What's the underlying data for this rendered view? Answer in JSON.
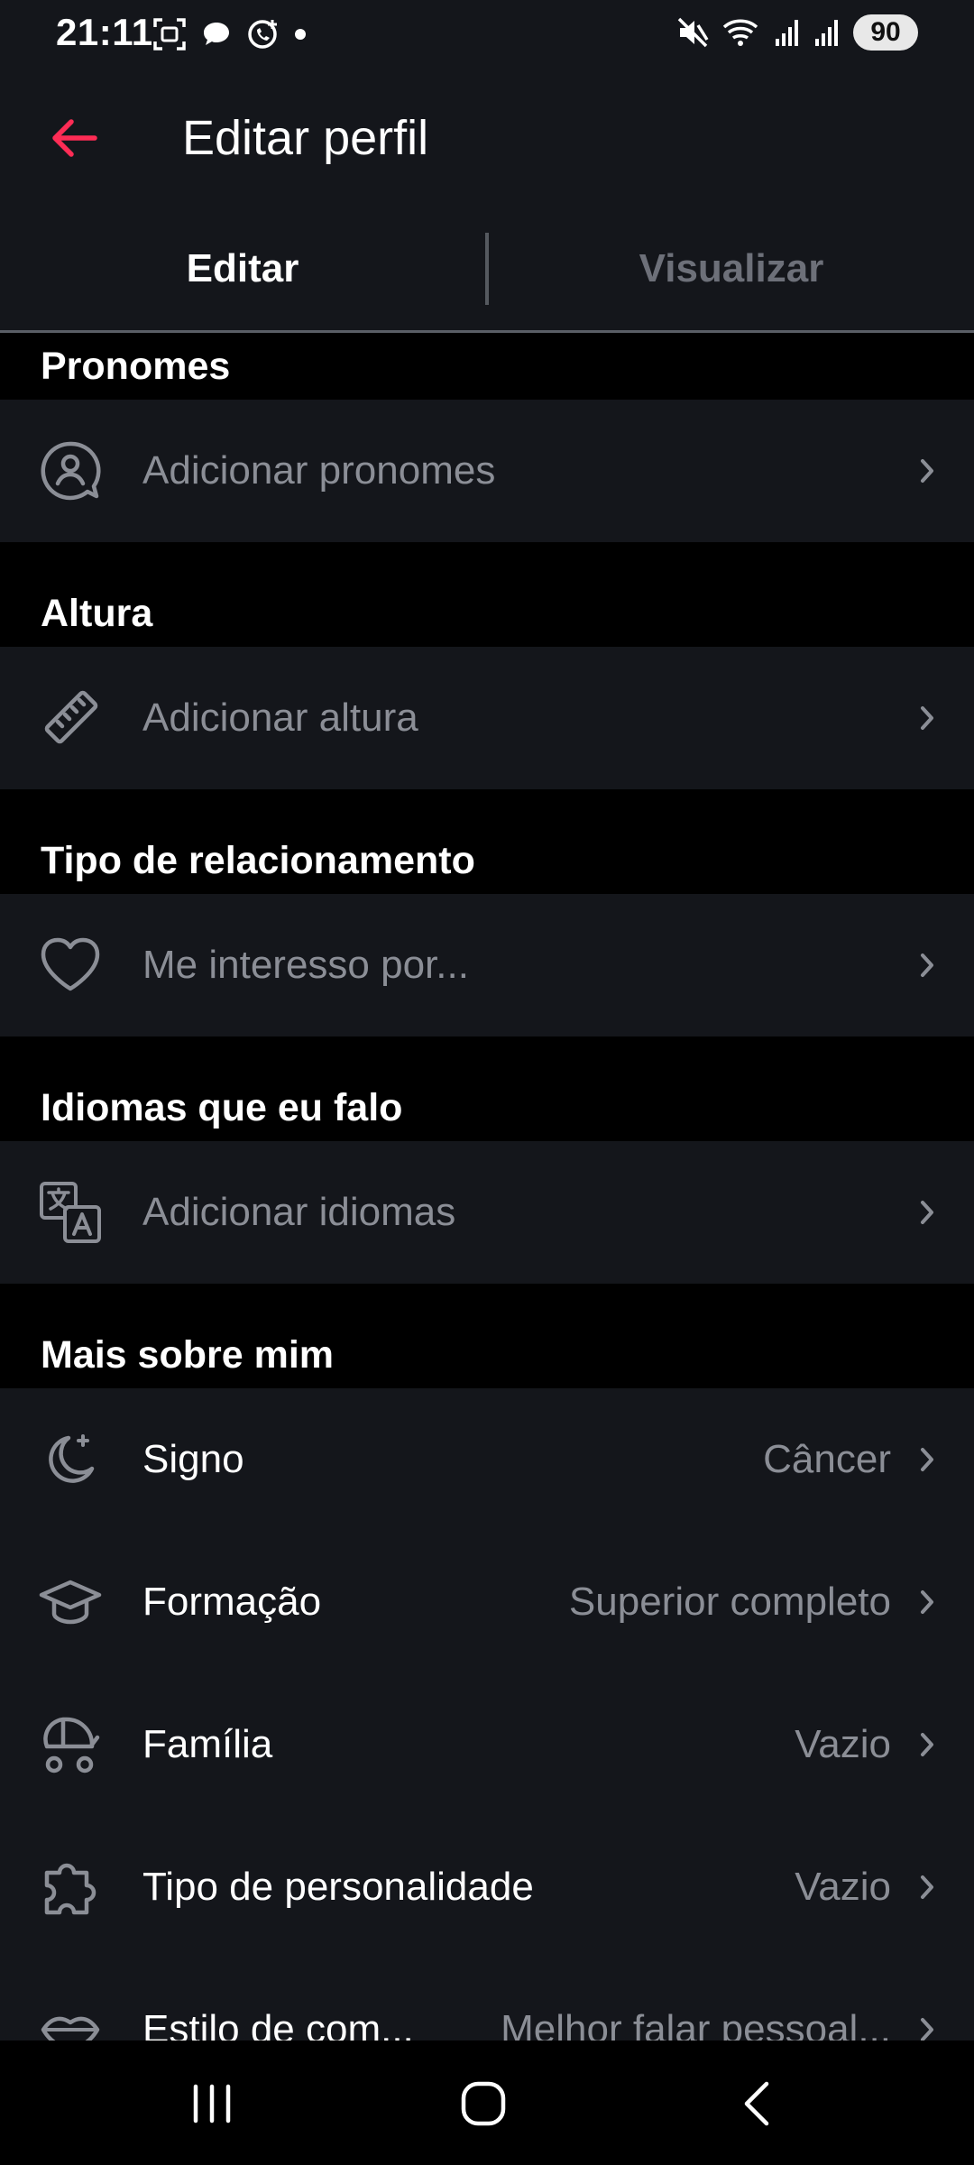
{
  "status_bar": {
    "time": "21:11",
    "battery": "90",
    "left_icons": [
      "screenshot-icon",
      "chat-bubble-icon",
      "whatsapp-icon",
      "dot-icon"
    ],
    "right_icons": [
      "mute-icon",
      "wifi-icon",
      "signal-icon",
      "signal-icon"
    ]
  },
  "header": {
    "title": "Editar perfil",
    "accent_color": "#fe2c55"
  },
  "tabs": [
    {
      "label": "Editar",
      "active": true
    },
    {
      "label": "Visualizar",
      "active": false
    }
  ],
  "sections": {
    "pronouns": {
      "title": "Pronomes",
      "row": {
        "icon": "person-bubble-icon",
        "label": "Adicionar pronomes"
      }
    },
    "height": {
      "title": "Altura",
      "row": {
        "icon": "ruler-icon",
        "label": "Adicionar altura"
      }
    },
    "relationship": {
      "title": "Tipo de relacionamento",
      "row": {
        "icon": "heart-icon",
        "label": "Me interesso por..."
      }
    },
    "languages": {
      "title": "Idiomas que eu falo",
      "row": {
        "icon": "translate-icon",
        "label": "Adicionar idiomas"
      }
    },
    "more_about_me": {
      "title": "Mais sobre mim",
      "rows": [
        {
          "icon": "moon-star-icon",
          "label": "Signo",
          "value": "Câncer"
        },
        {
          "icon": "graduation-cap-icon",
          "label": "Formação",
          "value": "Superior completo"
        },
        {
          "icon": "stroller-icon",
          "label": "Família",
          "value": "Vazio"
        },
        {
          "icon": "puzzle-icon",
          "label": "Tipo de personalidade",
          "value": "Vazio"
        },
        {
          "icon": "lips-icon",
          "label": "Estilo de com...",
          "value": "Melhor falar pessoal..."
        }
      ]
    }
  },
  "nav_bar": {
    "buttons": [
      "recent-apps-icon",
      "home-icon",
      "back-icon"
    ]
  }
}
